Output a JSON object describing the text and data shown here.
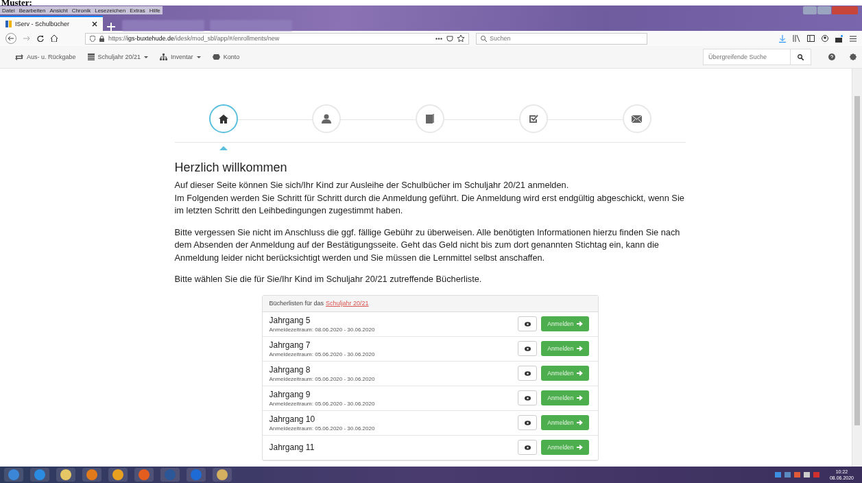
{
  "caption": "Muster:",
  "browser": {
    "menu": [
      "Datei",
      "Bearbeiten",
      "Ansicht",
      "Chronik",
      "Lesezeichen",
      "Extras",
      "Hilfe"
    ],
    "tabs": [
      {
        "title": "IServ - Schulbücher",
        "selected": true
      }
    ],
    "address": "https://**igs-buxtehude.de**/idesk/mod_sbl/app/#/enrollments/new",
    "search_placeholder": "Suchen"
  },
  "app_nav": {
    "items": [
      {
        "kind": "swap",
        "label": "Aus- u. Rückgabe",
        "dropdown": false
      },
      {
        "kind": "calendar",
        "label": "Schuljahr 20/21",
        "dropdown": true
      },
      {
        "kind": "sitemap",
        "label": "Inventar",
        "dropdown": true
      },
      {
        "kind": "badge",
        "label": "Konto",
        "dropdown": false
      }
    ],
    "search_placeholder": "Übergreifende Suche"
  },
  "steps": [
    {
      "kind": "home",
      "selected": true
    },
    {
      "kind": "user",
      "selected": false
    },
    {
      "kind": "book",
      "selected": false
    },
    {
      "kind": "check",
      "selected": false
    },
    {
      "kind": "envelope",
      "selected": false
    }
  ],
  "heading": "Herzlich willkommen",
  "paragraphs": [
    [
      "Auf dieser Seite können Sie sich/Ihr Kind zur Ausleihe der Schulbücher im Schuljahr 20/21 anmelden.",
      "Im Folgenden werden Sie Schritt für Schritt durch die Anmeldung geführt. Die Anmeldung wird erst endgültig abgeschickt, wenn Sie im letzten Schritt den Leihbedingungen zugestimmt haben."
    ],
    [
      "Bitte vergessen Sie nicht im Anschluss die ggf. fällige Gebühr zu überweisen. Alle benötigten Informationen hierzu finden Sie nach dem Absenden der Anmeldung auf der Bestätigungsseite. Geht das Geld nicht bis zum dort genannten Stichtag ein, kann die Anmeldung leider nicht berücksichtigt werden und Sie müssen die Lernmittel selbst anschaffen."
    ],
    [
      "Bitte wählen Sie die für Sie/Ihr Kind im Schuljahr 20/21 zutreffende Bücherliste."
    ]
  ],
  "booklist": {
    "header_text": "Bücherlisten für das",
    "header_link": "Schuljahr 20/21",
    "rows": [
      {
        "title": "Jahrgang 5",
        "period": "Anmeldezeitraum: 08.06.2020 - 30.06.2020",
        "button": "Anmelden"
      },
      {
        "title": "Jahrgang 7",
        "period": "Anmeldezeitraum: 05.06.2020 - 30.06.2020",
        "button": "Anmelden"
      },
      {
        "title": "Jahrgang 8",
        "period": "Anmeldezeitraum: 05.06.2020 - 30.06.2020",
        "button": "Anmelden"
      },
      {
        "title": "Jahrgang 9",
        "period": "Anmeldezeitraum: 05.06.2020 - 30.06.2020",
        "button": "Anmelden"
      },
      {
        "title": "Jahrgang 10",
        "period": "Anmeldezeitraum: 05.06.2020 - 30.06.2020",
        "button": "Anmelden"
      },
      {
        "title": "Jahrgang 11",
        "button": "Anmelden"
      }
    ]
  },
  "taskbar": {
    "time": "10:22",
    "date": "08.06.2020"
  }
}
